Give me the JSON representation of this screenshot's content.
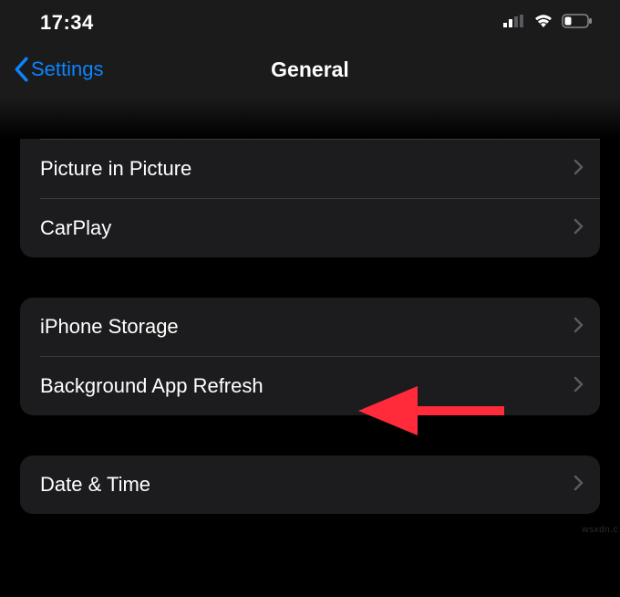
{
  "statusBar": {
    "time": "17:34"
  },
  "nav": {
    "back": "Settings",
    "title": "General"
  },
  "groups": {
    "g1": {
      "pip": "Picture in Picture",
      "carplay": "CarPlay"
    },
    "g2": {
      "storage": "iPhone Storage",
      "bgrefresh": "Background App Refresh"
    },
    "g3": {
      "datetime": "Date & Time"
    }
  },
  "watermark": "wsxdn.c",
  "colors": {
    "accent": "#0a84ff",
    "rowBg": "#1c1c1e",
    "arrow": "#ff2a3a"
  }
}
